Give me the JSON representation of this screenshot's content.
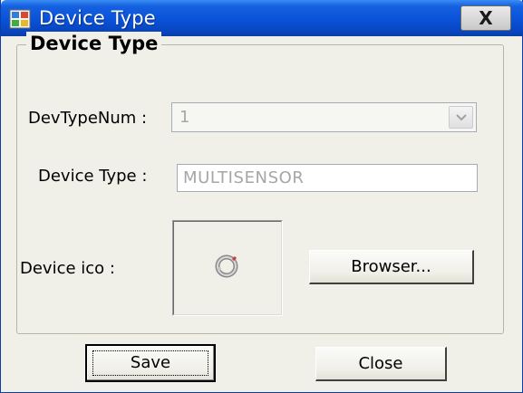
{
  "window": {
    "title": "Device Type",
    "close_label": "X",
    "icons": {
      "app": "device-type-app-icon",
      "close": "close-icon"
    }
  },
  "group": {
    "title": "Device Type"
  },
  "form": {
    "devtypenum_label": "DevTypeNum :",
    "devtypenum_value": "1",
    "devtypenum_arrow_icon": "chevron-down-icon",
    "devicetype_label": "Device Type :",
    "devicetype_value": "MULTISENSOR",
    "deviceico_label": "Device ico :",
    "device_icon": "multisensor-ring-icon"
  },
  "buttons": {
    "browser": "Browser...",
    "save": "Save",
    "close": "Close"
  },
  "colors": {
    "titlebar": "#0a52d8",
    "client_bg": "#f0efe8",
    "disabled_text": "#a6a6a6"
  }
}
